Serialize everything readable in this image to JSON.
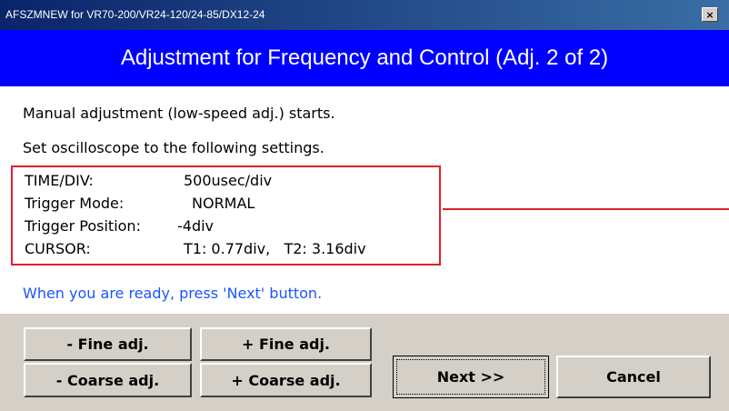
{
  "window": {
    "title": "AFSZMNEW for VR70-200/VR24-120/24-85/DX12-24",
    "close_glyph": "×"
  },
  "header": {
    "heading": "Adjustment for Frequency and Control (Adj. 2 of 2)",
    "background_color": "#0000ff"
  },
  "content": {
    "line1": "Manual adjustment (low-speed adj.) starts.",
    "line2": "Set oscilloscope to the following settings.",
    "settings": [
      {
        "label": "TIME/DIV:",
        "value": "500usec/div"
      },
      {
        "label": "Trigger Mode:",
        "value": "NORMAL"
      },
      {
        "label": "Trigger Position:",
        "value": "-4div"
      },
      {
        "label": "CURSOR:",
        "value": "T1: 0.77div,   T2: 3.16div"
      }
    ],
    "ready_text": "When you are ready, press 'Next' button.",
    "ready_color": "#1a55ff",
    "highlight_color": "#e0202a"
  },
  "buttons": {
    "fine_minus": "- Fine adj.",
    "fine_plus": "+ Fine adj.",
    "coarse_minus": "- Coarse adj.",
    "coarse_plus": "+ Coarse adj.",
    "next": "Next >>",
    "cancel": "Cancel"
  }
}
